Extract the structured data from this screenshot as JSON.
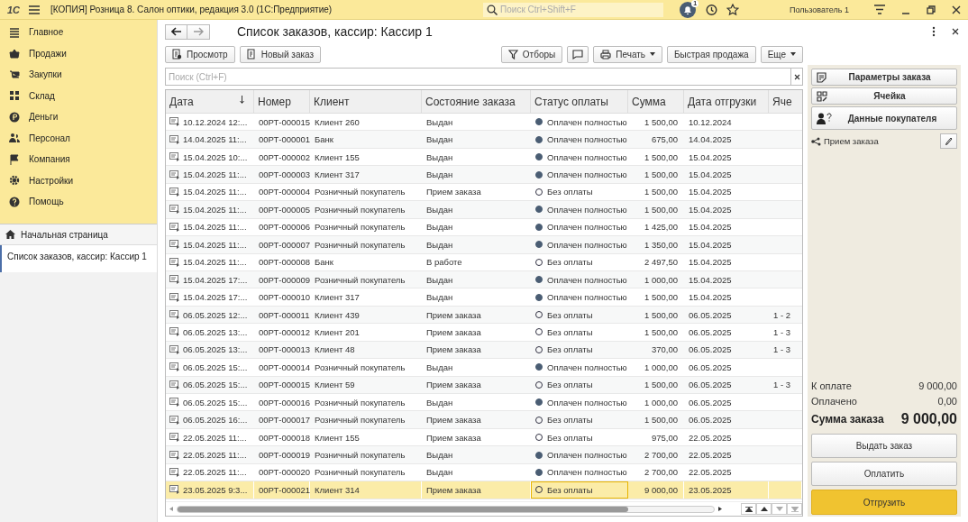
{
  "topbar": {
    "logo": "1С",
    "title": "[КОПИЯ] Розница 8. Салон оптики, редакция 3.0  (1С:Предприятие)",
    "search": {
      "placeholder": "Поиск Ctrl+Shift+F"
    },
    "notifications": "1",
    "user": "Пользователь 1"
  },
  "sidebar": {
    "items": [
      "Главное",
      "Продажи",
      "Закупки",
      "Склад",
      "Деньги",
      "Персонал",
      "Компания",
      "Настройки",
      "Помощь"
    ],
    "home": "Начальная страница",
    "open_windows": [
      {
        "label": "Список заказов, кассир: Кассир 1",
        "selected": true
      }
    ]
  },
  "form": {
    "title": "Список заказов, кассир: Кассир 1",
    "toolbar_left": [
      "Просмотр",
      "Новый заказ"
    ],
    "toolbar_right": [
      {
        "kind": "filter",
        "label": "Отборы"
      },
      {
        "kind": "comment"
      },
      {
        "kind": "print",
        "label": "Печать"
      },
      {
        "kind": "plain",
        "label": "Быстрая продажа"
      },
      {
        "kind": "more",
        "label": "Еще"
      }
    ],
    "search": {
      "placeholder": "Поиск (Ctrl+F)"
    },
    "table": {
      "columns": [
        "Дата",
        "Номер",
        "Клиент",
        "Состояние заказа",
        "Статус оплаты",
        "Сумма",
        "Дата отгрузки",
        "Яче"
      ],
      "rows": [
        {
          "date": "10.12.2024 12:...",
          "number": "00РТ-000015",
          "client": "Клиент 260",
          "state": "Выдан",
          "payment": "Оплачен полностью",
          "paid": true,
          "sum": "1 500,00",
          "ship": "10.12.2024",
          "selected": false
        },
        {
          "date": "14.04.2025 11:...",
          "number": "00РТ-000001",
          "client": "Банк",
          "state": "Выдан",
          "payment": "Оплачен полностью",
          "paid": true,
          "sum": "675,00",
          "ship": "14.04.2025",
          "selected": false
        },
        {
          "date": "15.04.2025 10:...",
          "number": "00РТ-000002",
          "client": "Клиент 155",
          "state": "Выдан",
          "payment": "Оплачен полностью",
          "paid": true,
          "sum": "1 500,00",
          "ship": "15.04.2025",
          "selected": false
        },
        {
          "date": "15.04.2025 11:...",
          "number": "00РТ-000003",
          "client": "Клиент 317",
          "state": "Выдан",
          "payment": "Оплачен полностью",
          "paid": true,
          "sum": "1 500,00",
          "ship": "15.04.2025",
          "selected": false
        },
        {
          "date": "15.04.2025 11:...",
          "number": "00РТ-000004",
          "client": "Розничный покупатель",
          "state": "Прием заказа",
          "payment": "Без оплаты",
          "paid": false,
          "sum": "1 500,00",
          "ship": "15.04.2025",
          "selected": false
        },
        {
          "date": "15.04.2025 11:...",
          "number": "00РТ-000005",
          "client": "Розничный покупатель",
          "state": "Выдан",
          "payment": "Оплачен полностью",
          "paid": true,
          "sum": "1 500,00",
          "ship": "15.04.2025",
          "selected": false
        },
        {
          "date": "15.04.2025 11:...",
          "number": "00РТ-000006",
          "client": "Розничный покупатель",
          "state": "Выдан",
          "payment": "Оплачен полностью",
          "paid": true,
          "sum": "1 425,00",
          "ship": "15.04.2025",
          "selected": false
        },
        {
          "date": "15.04.2025 11:...",
          "number": "00РТ-000007",
          "client": "Розничный покупатель",
          "state": "Выдан",
          "payment": "Оплачен полностью",
          "paid": true,
          "sum": "1 350,00",
          "ship": "15.04.2025",
          "selected": false
        },
        {
          "date": "15.04.2025 11:...",
          "number": "00РТ-000008",
          "client": "Банк",
          "state": "В работе",
          "payment": "Без оплаты",
          "paid": false,
          "sum": "2 497,50",
          "ship": "15.04.2025",
          "selected": false
        },
        {
          "date": "15.04.2025 17:...",
          "number": "00РТ-000009",
          "client": "Розничный покупатель",
          "state": "Выдан",
          "payment": "Оплачен полностью",
          "paid": true,
          "sum": "1 000,00",
          "ship": "15.04.2025",
          "selected": false
        },
        {
          "date": "15.04.2025 17:...",
          "number": "00РТ-000010",
          "client": "Клиент 317",
          "state": "Выдан",
          "payment": "Оплачен полностью",
          "paid": true,
          "sum": "1 500,00",
          "ship": "15.04.2025",
          "selected": false
        },
        {
          "date": "06.05.2025 12:...",
          "number": "00РТ-000011",
          "client": "Клиент 439",
          "state": "Прием заказа",
          "payment": "Без оплаты",
          "paid": false,
          "sum": "1 500,00",
          "ship": "06.05.2025",
          "cell": "1 - 2",
          "selected": false
        },
        {
          "date": "06.05.2025 13:...",
          "number": "00РТ-000012",
          "client": "Клиент 201",
          "state": "Прием заказа",
          "payment": "Без оплаты",
          "paid": false,
          "sum": "1 500,00",
          "ship": "06.05.2025",
          "cell": "1 - 3",
          "selected": false
        },
        {
          "date": "06.05.2025 13:...",
          "number": "00РТ-000013",
          "client": "Клиент 48",
          "state": "Прием заказа",
          "payment": "Без оплаты",
          "paid": false,
          "sum": "370,00",
          "ship": "06.05.2025",
          "cell": "1 - 3",
          "selected": false
        },
        {
          "date": "06.05.2025 15:...",
          "number": "00РТ-000014",
          "client": "Розничный покупатель",
          "state": "Выдан",
          "payment": "Оплачен полностью",
          "paid": true,
          "sum": "1 000,00",
          "ship": "06.05.2025",
          "selected": false
        },
        {
          "date": "06.05.2025 15:...",
          "number": "00РТ-000015",
          "client": "Клиент 59",
          "state": "Прием заказа",
          "payment": "Без оплаты",
          "paid": false,
          "sum": "1 500,00",
          "ship": "06.05.2025",
          "cell": "1 - 3",
          "selected": false
        },
        {
          "date": "06.05.2025 15:...",
          "number": "00РТ-000016",
          "client": "Розничный покупатель",
          "state": "Выдан",
          "payment": "Оплачен полностью",
          "paid": true,
          "sum": "1 000,00",
          "ship": "06.05.2025",
          "selected": false
        },
        {
          "date": "06.05.2025 16:...",
          "number": "00РТ-000017",
          "client": "Розничный покупатель",
          "state": "Прием заказа",
          "payment": "Без оплаты",
          "paid": false,
          "sum": "1 500,00",
          "ship": "06.05.2025",
          "selected": false
        },
        {
          "date": "22.05.2025 11:...",
          "number": "00РТ-000018",
          "client": "Клиент 155",
          "state": "Прием заказа",
          "payment": "Без оплаты",
          "paid": false,
          "sum": "975,00",
          "ship": "22.05.2025",
          "selected": false
        },
        {
          "date": "22.05.2025 11:...",
          "number": "00РТ-000019",
          "client": "Розничный покупатель",
          "state": "Выдан",
          "payment": "Оплачен полностью",
          "paid": true,
          "sum": "2 700,00",
          "ship": "22.05.2025",
          "selected": false
        },
        {
          "date": "22.05.2025 11:...",
          "number": "00РТ-000020",
          "client": "Розничный покупатель",
          "state": "Выдан",
          "payment": "Оплачен полностью",
          "paid": true,
          "sum": "2 700,00",
          "ship": "22.05.2025",
          "selected": false
        },
        {
          "date": "23.05.2025 9:3...",
          "number": "00РТ-000021",
          "client": "Клиент 314",
          "state": "Прием заказа",
          "payment": "Без оплаты",
          "paid": false,
          "sum": "9 000,00",
          "ship": "23.05.2025",
          "selected": true
        }
      ]
    }
  },
  "panel": {
    "buttons": [
      "Параметры заказа",
      "Ячейка",
      "Данные покупателя"
    ],
    "status": "Прием заказа",
    "totals": [
      {
        "label": "К оплате",
        "value": "9 000,00",
        "kind": "normal"
      },
      {
        "label": "Оплачено",
        "value": "0,00",
        "kind": "normal"
      },
      {
        "label": "Сумма заказа",
        "value": "9 000,00",
        "kind": "total"
      }
    ],
    "actions": [
      {
        "label": "Выдать заказ",
        "kind": "plain"
      },
      {
        "label": "Оплатить",
        "kind": "plain"
      },
      {
        "label": "Отгрузить",
        "kind": "primary"
      }
    ]
  }
}
